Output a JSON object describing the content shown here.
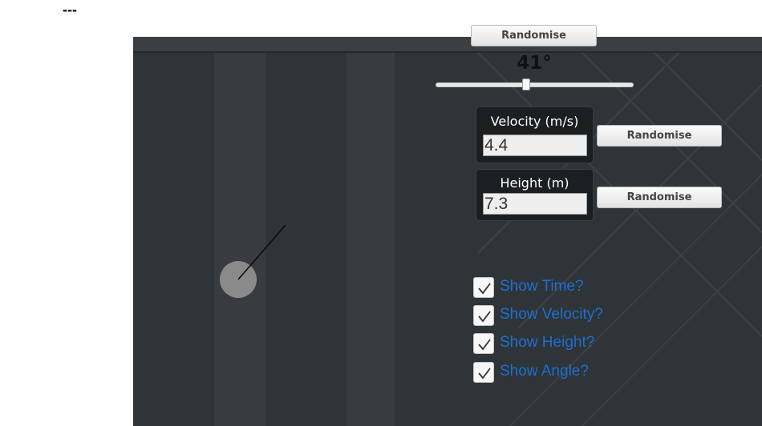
{
  "header": {
    "marker": "---"
  },
  "controls": {
    "top_button": "Randomise",
    "angle": {
      "label": "41°",
      "value": 41,
      "min": 0,
      "max": 90
    },
    "velocity": {
      "title": "Velocity (m/s)",
      "value": "4.4",
      "button": "Randomise"
    },
    "height": {
      "title": "Height (m)",
      "value": "7.3",
      "button": "Randomise"
    }
  },
  "options": [
    {
      "label": "Show Time?",
      "checked": true
    },
    {
      "label": "Show Velocity?",
      "checked": true
    },
    {
      "label": "Show Height?",
      "checked": true
    },
    {
      "label": "Show Angle?",
      "checked": true
    }
  ],
  "colors": {
    "stage": "#2f3438",
    "projectile": "#8a8a8a",
    "option_text": "#1d6fd0"
  }
}
